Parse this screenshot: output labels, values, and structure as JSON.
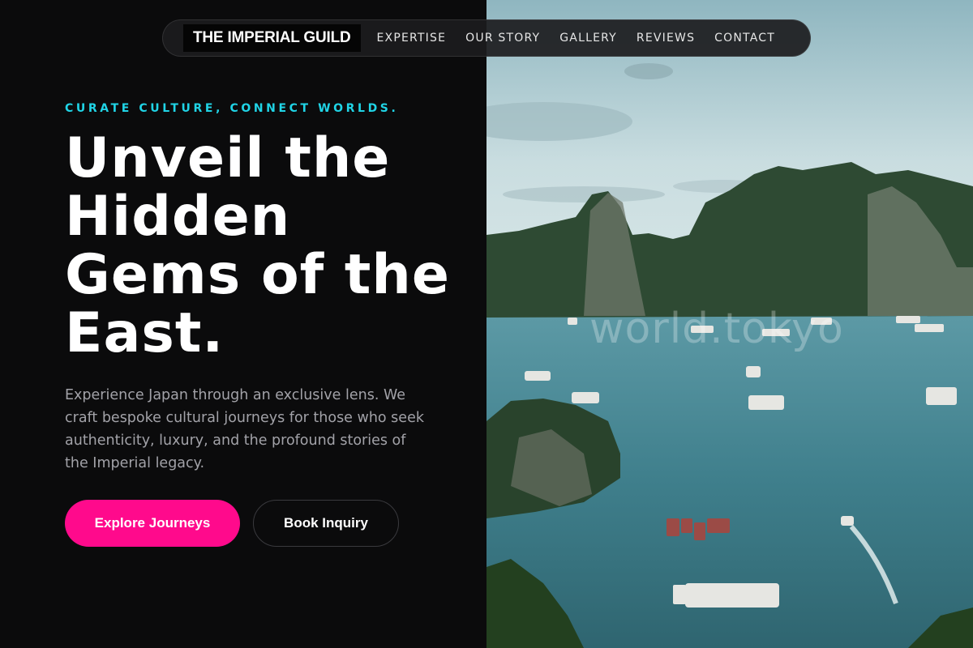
{
  "nav": {
    "brand": "THE IMPERIAL GUILD",
    "links": [
      "EXPERTISE",
      "OUR STORY",
      "GALLERY",
      "REVIEWS",
      "CONTACT"
    ]
  },
  "hero": {
    "tagline": "CURATE CULTURE, CONNECT WORLDS.",
    "headline": "Unveil the Hidden Gems of the East.",
    "intro": "Experience Japan through an exclusive lens. We craft bespoke cultural journeys for those who seek authenticity, luxury, and the profound stories of the Imperial legacy.",
    "primary_cta": "Explore Journeys",
    "secondary_cta": "Book Inquiry"
  },
  "image": {
    "watermark": "world.tokyo"
  },
  "colors": {
    "accent_pink": "#ff0a8c",
    "accent_cyan": "#20d4e6",
    "background": "#0b0b0c"
  }
}
